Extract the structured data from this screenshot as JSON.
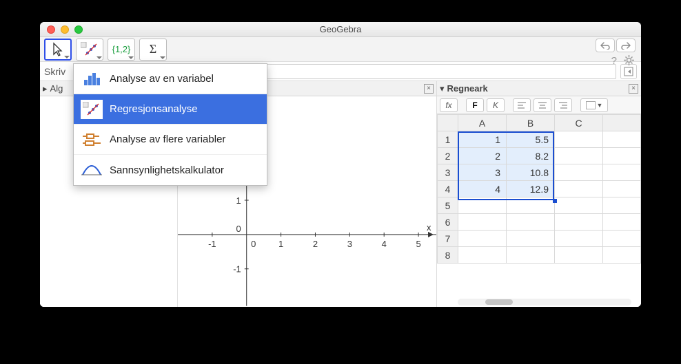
{
  "window": {
    "title": "GeoGebra"
  },
  "toolbar": {
    "list_label": "{1,2}",
    "sigma_label": "Σ"
  },
  "dropdown": {
    "items": [
      {
        "label": "Analyse av en variabel",
        "highlight": false
      },
      {
        "label": "Regresjonsanalyse",
        "highlight": true
      },
      {
        "label": "Analyse av flere variabler",
        "highlight": false
      },
      {
        "label": "Sannsynlighetskalkulator",
        "highlight": false
      }
    ]
  },
  "inputbar": {
    "label": "Skriv"
  },
  "left_pane": {
    "header": "Alg"
  },
  "right_pane": {
    "header": "Regneark"
  },
  "sheet_toolbar": {
    "fx": "fx",
    "bold": "F",
    "italic": "K"
  },
  "spreadsheet": {
    "columns": [
      "A",
      "B",
      "C"
    ],
    "rows": [
      {
        "n": "1",
        "A": "1",
        "B": "5.5",
        "C": ""
      },
      {
        "n": "2",
        "A": "2",
        "B": "8.2",
        "C": ""
      },
      {
        "n": "3",
        "A": "3",
        "B": "10.8",
        "C": ""
      },
      {
        "n": "4",
        "A": "4",
        "B": "12.9",
        "C": ""
      },
      {
        "n": "5",
        "A": "",
        "B": "",
        "C": ""
      },
      {
        "n": "6",
        "A": "",
        "B": "",
        "C": ""
      },
      {
        "n": "7",
        "A": "",
        "B": "",
        "C": ""
      },
      {
        "n": "8",
        "A": "",
        "B": "",
        "C": ""
      }
    ]
  },
  "axes": {
    "x_ticks": [
      "-1",
      "0",
      "1",
      "2",
      "3",
      "4",
      "5"
    ],
    "y_ticks": [
      "1",
      "0",
      "-1"
    ],
    "x_label": "x"
  }
}
